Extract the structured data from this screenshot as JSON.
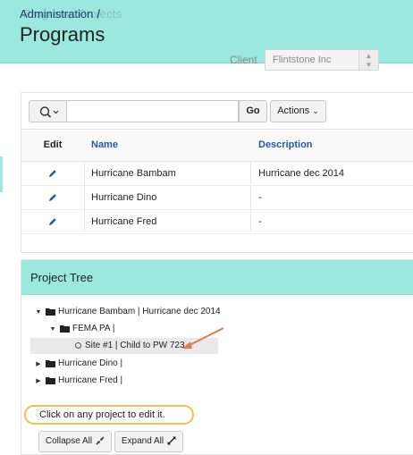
{
  "header": {
    "breadcrumb_parent": "Administration",
    "breadcrumb_sep": "/",
    "breadcrumb_overlay": "Programs Projects",
    "title": "Programs"
  },
  "client": {
    "label": "Client",
    "value": "Flintstone Inc"
  },
  "report": {
    "go_label": "Go",
    "actions_label": "Actions",
    "columns": {
      "edit": "Edit",
      "name": "Name",
      "description": "Description"
    },
    "rows": [
      {
        "name": "Hurricane Bambam",
        "description": "Hurricane dec 2014"
      },
      {
        "name": "Hurricane Dino",
        "description": "-"
      },
      {
        "name": "Hurricane Fred",
        "description": "-"
      }
    ]
  },
  "tree": {
    "title": "Project Tree",
    "nodes": [
      {
        "label": "Hurricane Bambam | Hurricane dec 2014",
        "expanded": true
      },
      {
        "label": "FEMA PA |",
        "expanded": true
      },
      {
        "label": "Site #1 | Child to PW 723",
        "selected": true
      },
      {
        "label": "Hurricane Dino |",
        "expanded": false
      },
      {
        "label": "Hurricane Fred |",
        "expanded": false
      }
    ],
    "hint": "Click on any project to edit it.",
    "collapse_label": "Collapse All",
    "expand_label": "Expand All"
  },
  "colors": {
    "header_bg": "#9be9de",
    "link_blue": "#1f5aa6",
    "highlight_yellow": "#e3c84b",
    "annotation_arrow": "#e8774f"
  }
}
